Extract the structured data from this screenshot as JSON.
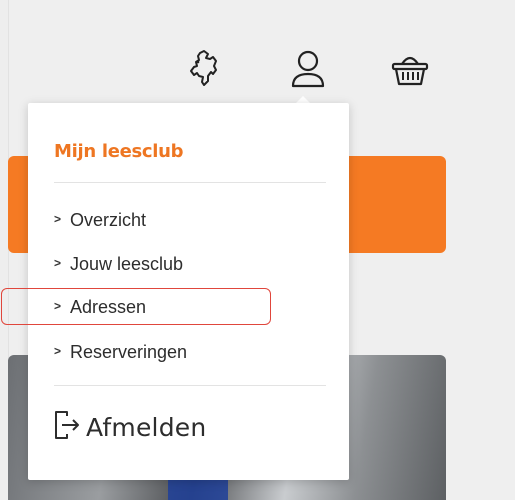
{
  "header": {
    "icons": [
      {
        "name": "netherlands-map-icon"
      },
      {
        "name": "user-account-icon"
      },
      {
        "name": "basket-icon"
      }
    ]
  },
  "menu": {
    "title": "Mijn leesclub",
    "items": [
      {
        "label": "Overzicht"
      },
      {
        "label": "Jouw leesclub"
      },
      {
        "label": "Adressen",
        "highlighted": true
      },
      {
        "label": "Reserveringen"
      }
    ],
    "logout_label": "Afmelden"
  },
  "colors": {
    "accent": "#f57a23",
    "highlight_border": "#e0463c",
    "text": "#2d2d2d"
  }
}
